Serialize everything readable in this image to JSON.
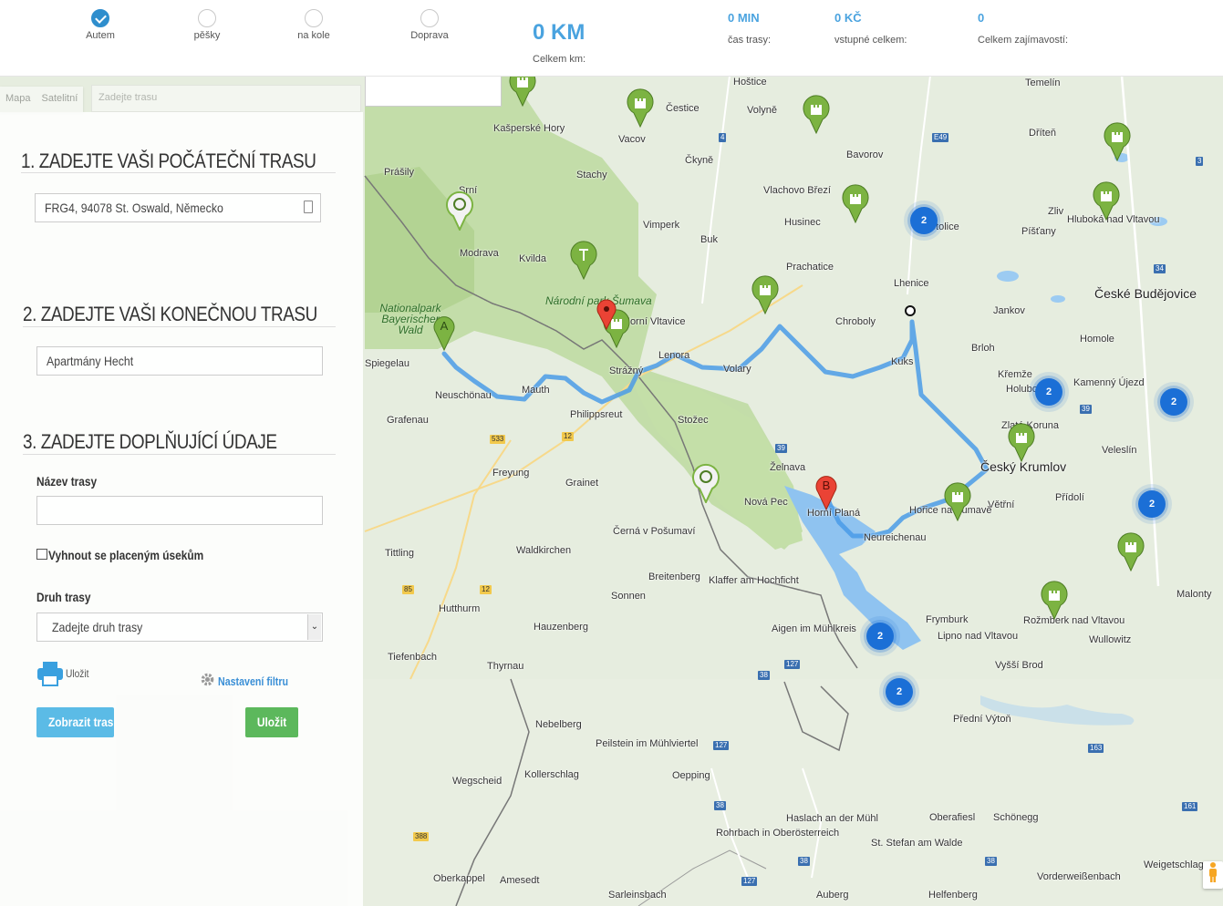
{
  "modes": [
    {
      "label": "Autem",
      "selected": true
    },
    {
      "label": "pěšky",
      "selected": false
    },
    {
      "label": "na kole",
      "selected": false
    },
    {
      "label": "Doprava",
      "selected": false
    }
  ],
  "stats": {
    "distance_value": "0 KM",
    "distance_label": "Celkem km:",
    "time_value": "0 MIN",
    "time_label": "čas trasy:",
    "fee_value": "0 KČ",
    "fee_label": "vstupné celkem:",
    "poi_value": "0",
    "poi_label": "Celkem zajímavostí:"
  },
  "map_ui": {
    "tab_map": "Mapa",
    "tab_satellite": "Satelitní",
    "search_placeholder": "Zadejte trasu"
  },
  "form": {
    "step1_title": "1. ZADEJTE VAŠI POČÁTEČNÍ TRASU",
    "start_value": "FRG4, 94078 St. Oswald, Německo",
    "step2_title": "2. ZADEJTE VAŠI KONEČNOU TRASU",
    "end_value": "Apartmány Hecht",
    "step3_title": "3. ZADEJTE DOPLŇUJÍCÍ ÚDAJE",
    "route_name_label": "Název trasy",
    "route_name_value": "",
    "avoid_toll_label": "Vyhnout se placeným úsekům",
    "route_type_label": "Druh trasy",
    "route_type_value": "Zadejte druh trasy",
    "print_label": "Uložit",
    "filter_label": "Nastavení filtru",
    "show_route_button": "Zobrazit trasu",
    "save_button": "Uložit"
  },
  "map_labels": {
    "towns": [
      "Hoštice",
      "Temelín",
      "Kašperské Hory",
      "Čestice",
      "Volyně",
      "Vacov",
      "Dříteň",
      "Prášily",
      "Stachy",
      "Čkyně",
      "Bavorov",
      "Vlachovo Březí",
      "Srní",
      "Zliv",
      "Vimperk",
      "Husinec",
      "Netolice",
      "Píšťany",
      "Hluboká nad Vltavou",
      "Modrava",
      "Kvilda",
      "Buk",
      "Prachatice",
      "Lhenice",
      "České Budějovice",
      "Jankov",
      "Chroboly",
      "Horní Vltavice",
      "Spiegelau",
      "Brloh",
      "Homole",
      "Lenora",
      "Volary",
      "Kuks",
      "Strážný",
      "Křemže",
      "Holubov",
      "Kamenný Újezd",
      "Neuschönau",
      "Mauth",
      "Philippsreut",
      "Grafenau",
      "Stožec",
      "Zlatá Koruna",
      "Veleslín",
      "Český Krumlov",
      "Freyung",
      "Želnava",
      "Grainet",
      "Nová Pec",
      "Horní Planá",
      "Větřní",
      "Přídolí",
      "Hořice na Šumavě",
      "Neureichenau",
      "Černá v Pošumaví",
      "Tittling",
      "Waldkirchen",
      "Breitenberg",
      "Klaffer am Hochficht",
      "Sonnen",
      "Frymburk",
      "Rožmberk nad Vltavou",
      "Malonty",
      "Hutthurm",
      "Hauzenberg",
      "Aigen im Mühlkreis",
      "Lipno nad Vltavou",
      "Wullowitz",
      "Tiefenbach",
      "Thyrnau",
      "Vyšší Brod",
      "Nebelberg",
      "Peilstein im Mühlviertel",
      "Přední Výtoň",
      "Kollerschlag",
      "Oepping",
      "Wegscheid",
      "Oberafiesl",
      "Schönegg",
      "Haslach an der Mühl",
      "Rohrbach in Oberösterreich",
      "St. Stefan am Walde",
      "Weigetschlag",
      "Oberkappel",
      "Amesedt",
      "Sarleinsbach",
      "Auberg",
      "Helfenberg",
      "Vorderweißenbach"
    ],
    "parks": [
      "Národní park Šumava",
      "Nationalpark Bayerischer Wald"
    ],
    "roads": [
      "4",
      "E49",
      "3",
      "34",
      "39",
      "533",
      "12",
      "85",
      "127",
      "38",
      "163",
      "161",
      "388"
    ],
    "clusters": [
      "2",
      "2",
      "2",
      "2",
      "2",
      "2"
    ],
    "route_markers": [
      "A",
      "B"
    ]
  }
}
